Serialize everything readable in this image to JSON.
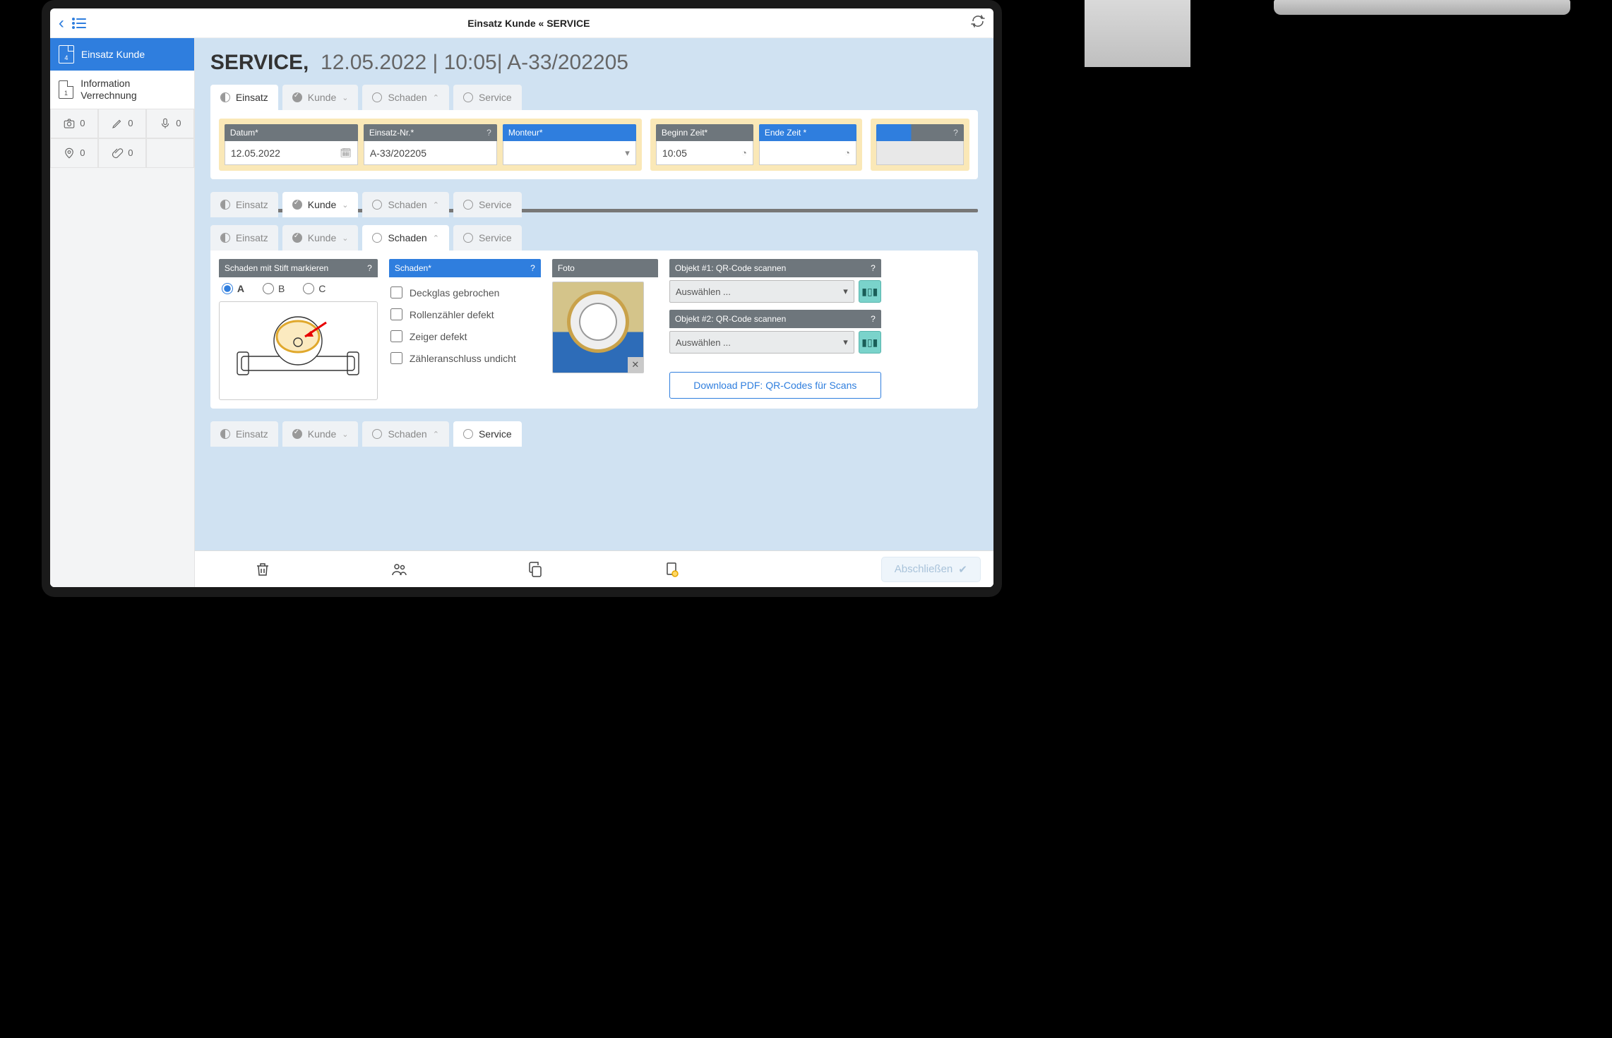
{
  "topbar": {
    "title": "Einsatz Kunde « SERVICE"
  },
  "sidebar": {
    "item1": {
      "badge": "4",
      "label": "Einsatz Kunde"
    },
    "item2": {
      "badge": "1",
      "label": "Information Verrechnung"
    },
    "counts": {
      "camera": "0",
      "pencil": "0",
      "mic": "0",
      "pin": "0",
      "clip": "0"
    }
  },
  "page": {
    "svc": "SERVICE,",
    "rest": "12.05.2022 | 10:05| A-33/202205"
  },
  "tabs": {
    "t1": "Einsatz",
    "t2": "Kunde",
    "t3": "Schaden",
    "t4": "Service"
  },
  "einsatz": {
    "datum_label": "Datum*",
    "datum_value": "12.05.2022",
    "nr_label": "Einsatz-Nr.*",
    "nr_value": "A-33/202205",
    "monteur_label": "Monteur*",
    "beginn_label": "Beginn Zeit*",
    "beginn_value": "10:05",
    "ende_label": "Ende Zeit *",
    "blank_label": ""
  },
  "schaden": {
    "mark_label": "Schaden mit Stift markieren",
    "optA": "A",
    "optB": "B",
    "optC": "C",
    "list_label": "Schaden*",
    "c1": "Deckglas gebrochen",
    "c2": "Rollenzähler defekt",
    "c3": "Zeiger defekt",
    "c4": "Zähleranschluss undicht",
    "foto_label": "Foto",
    "qr1_label": "Objekt #1: QR-Code scannen",
    "qr2_label": "Objekt #2: QR-Code scannen",
    "select_placeholder": "Auswählen ...",
    "dl_label": "Download PDF: QR-Codes für Scans"
  },
  "bottombar": {
    "finish": "Abschließen"
  }
}
